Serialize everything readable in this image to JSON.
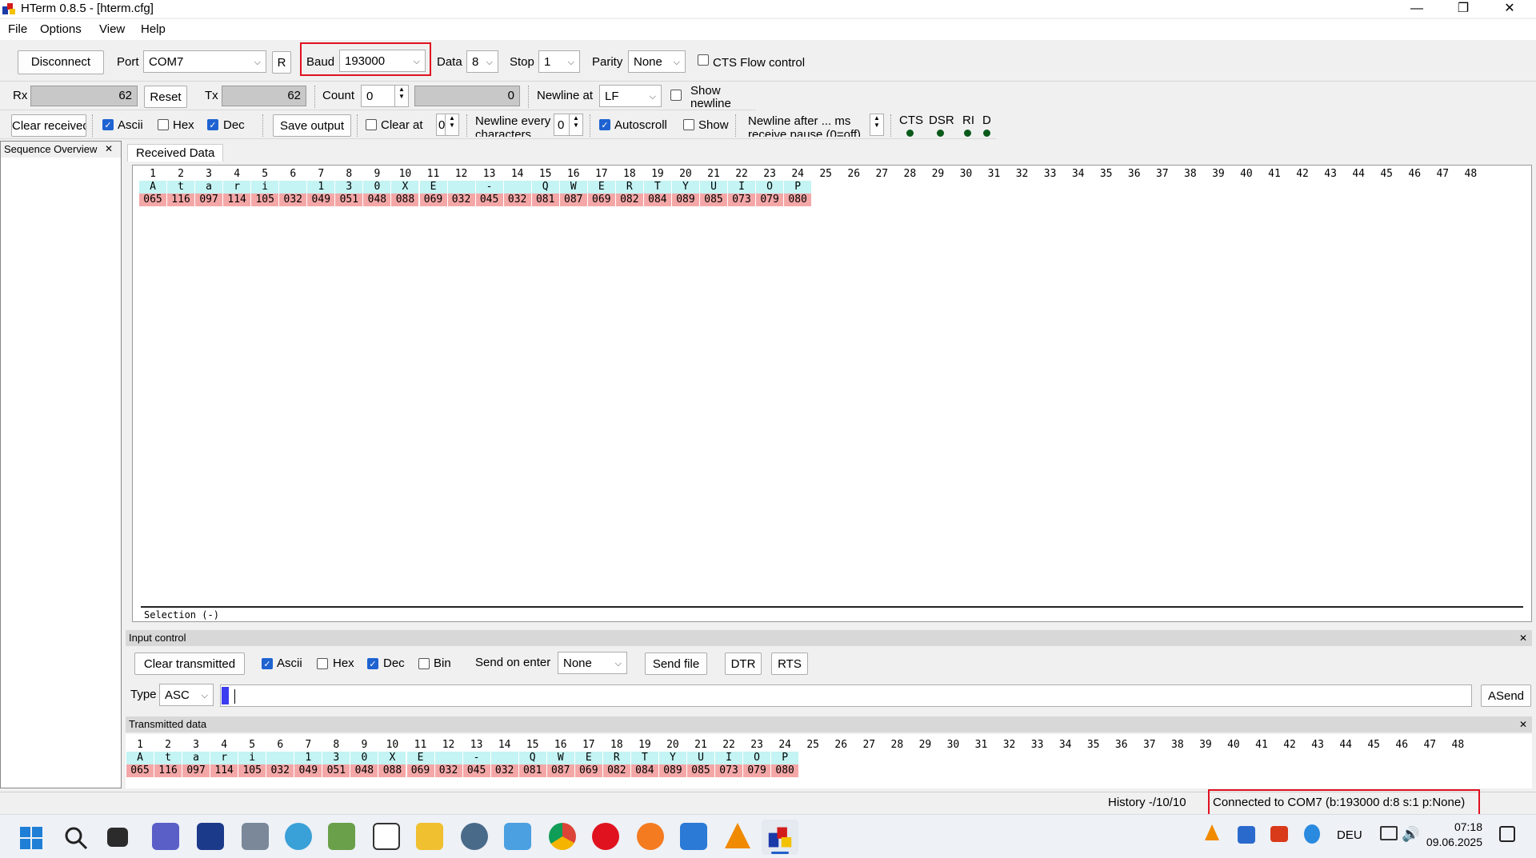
{
  "window": {
    "title": "HTerm 0.8.5 - [hterm.cfg]",
    "min": "—",
    "max": "❐",
    "close": "✕"
  },
  "menu": [
    "File",
    "Options",
    "View",
    "Help"
  ],
  "toolbar1": {
    "disconnect": "Disconnect",
    "port_label": "Port",
    "port_value": "COM7",
    "r_button": "R",
    "baud_label": "Baud",
    "baud_value": "193000",
    "data_label": "Data",
    "data_value": "8",
    "stop_label": "Stop",
    "stop_value": "1",
    "parity_label": "Parity",
    "parity_value": "None",
    "cts_label": "CTS Flow control"
  },
  "toolbar2": {
    "rx_label": "Rx",
    "rx_value": "62",
    "reset": "Reset",
    "tx_label": "Tx",
    "tx_value": "62",
    "count_label": "Count",
    "count_value": "0",
    "count_field": "0",
    "newline_label": "Newline at",
    "newline_value": "LF",
    "show_newline": "Show newline"
  },
  "toolbar3": {
    "clear_received": "Clear received",
    "ascii": "Ascii",
    "hex": "Hex",
    "dec": "Dec",
    "save_output": "Save output",
    "clear_at": "Clear at",
    "clear_at_value": "0",
    "newline_every": "Newline every characters",
    "newline_every_value": "0",
    "autoscroll": "Autoscroll",
    "show": "Show",
    "newline_after": "Newline after ... ms receive pause (0=off)",
    "leds": [
      "CTS",
      "DSR",
      "RI",
      "DCD"
    ]
  },
  "sidebar": {
    "title": "Sequence Overview",
    "close": "✕"
  },
  "received": {
    "tab": "Received Data",
    "indices": [
      "1",
      "2",
      "3",
      "4",
      "5",
      "6",
      "7",
      "8",
      "9",
      "10",
      "11",
      "12",
      "13",
      "14",
      "15",
      "16",
      "17",
      "18",
      "19",
      "20",
      "21",
      "22",
      "23",
      "24",
      "25",
      "26",
      "27",
      "28",
      "29",
      "30",
      "31",
      "32",
      "33",
      "34",
      "35",
      "36",
      "37",
      "38",
      "39",
      "40",
      "41",
      "42",
      "43",
      "44",
      "45",
      "46",
      "47",
      "48"
    ],
    "ascii": [
      "A",
      "t",
      "a",
      "r",
      "i",
      "",
      "1",
      "3",
      "0",
      "X",
      "E",
      "",
      "-",
      "",
      "Q",
      "W",
      "E",
      "R",
      "T",
      "Y",
      "U",
      "I",
      "O",
      "P"
    ],
    "dec": [
      "065",
      "116",
      "097",
      "114",
      "105",
      "032",
      "049",
      "051",
      "048",
      "088",
      "069",
      "032",
      "045",
      "032",
      "081",
      "087",
      "069",
      "082",
      "084",
      "089",
      "085",
      "073",
      "079",
      "080"
    ],
    "selection": "Selection (-)"
  },
  "input_control": {
    "title": "Input control",
    "close": "✕",
    "clear_transmitted": "Clear transmitted",
    "ascii": "Ascii",
    "hex": "Hex",
    "dec": "Dec",
    "bin": "Bin",
    "send_on_enter": "Send on enter",
    "send_on_enter_value": "None",
    "send_file": "Send file",
    "dtr": "DTR",
    "rts": "RTS",
    "type_label": "Type",
    "type_value": "ASC",
    "asend": "ASend"
  },
  "transmitted": {
    "title": "Transmitted data",
    "close": "✕"
  },
  "status": {
    "history": "History -/10/10",
    "connection": "Connected to COM7 (b:193000 d:8 s:1 p:None)"
  },
  "taskbar": {
    "lang": "DEU",
    "time": "07:18",
    "date": "09.06.2025"
  }
}
